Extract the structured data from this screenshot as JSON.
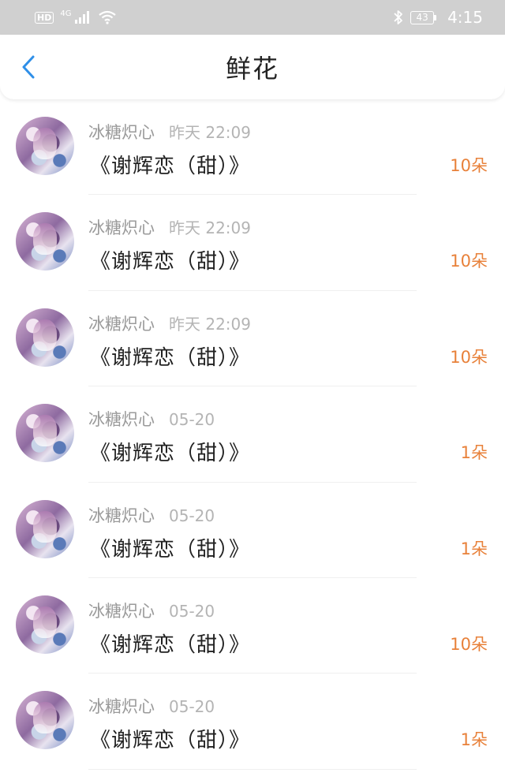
{
  "status_bar": {
    "hd": "HD",
    "network": "4G",
    "battery": "43",
    "time": "4:15"
  },
  "header": {
    "title": "鲜花"
  },
  "gifts": [
    {
      "user": "冰糖炽心",
      "time": "昨天 22:09",
      "book": "《谢辉恋（甜）》",
      "count": "10朵"
    },
    {
      "user": "冰糖炽心",
      "time": "昨天 22:09",
      "book": "《谢辉恋（甜）》",
      "count": "10朵"
    },
    {
      "user": "冰糖炽心",
      "time": "昨天 22:09",
      "book": "《谢辉恋（甜）》",
      "count": "10朵"
    },
    {
      "user": "冰糖炽心",
      "time": "05-20",
      "book": "《谢辉恋（甜）》",
      "count": "1朵"
    },
    {
      "user": "冰糖炽心",
      "time": "05-20",
      "book": "《谢辉恋（甜）》",
      "count": "1朵"
    },
    {
      "user": "冰糖炽心",
      "time": "05-20",
      "book": "《谢辉恋（甜）》",
      "count": "10朵"
    },
    {
      "user": "冰糖炽心",
      "time": "05-20",
      "book": "《谢辉恋（甜）》",
      "count": "1朵"
    }
  ],
  "colors": {
    "accent_blue": "#2f8fe8",
    "count_orange": "#e8813a",
    "status_bar": "#d0d0d0"
  }
}
